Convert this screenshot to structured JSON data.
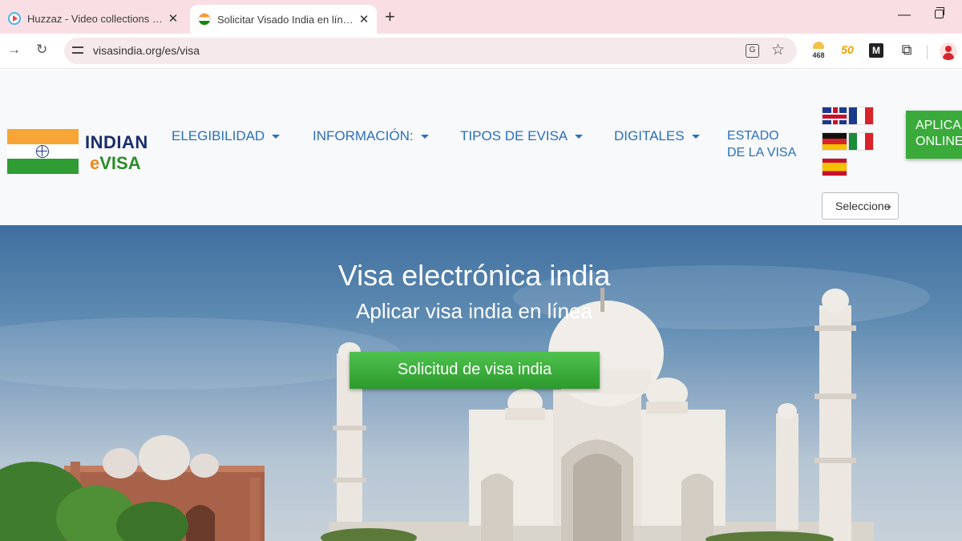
{
  "browser": {
    "tabs": [
      {
        "title": "Huzzaz - Video collections by k",
        "favicon": "huzzaz-play-icon",
        "active": false
      },
      {
        "title": "Solicitar Visado India en línea, S",
        "favicon": "india-flag-icon",
        "active": true
      }
    ],
    "new_tab_label": "+",
    "close_label": "✕",
    "url": "visasindia.org/es/visa",
    "extensions": {
      "weather_temp": "468",
      "fifty_label": "50",
      "m_label": "M"
    }
  },
  "site": {
    "logo": {
      "line1": "INDIAN",
      "line2_e": "e",
      "line2_rest": "VISA"
    },
    "nav": {
      "elegibilidad": "ELEGIBILIDAD",
      "informacion": "INFORMACIÓN:",
      "tipos": "TIPOS DE EVISA",
      "digitales": "DIGITALES",
      "estado_line1": "ESTADO",
      "estado_line2": "DE LA VISA"
    },
    "languages": [
      "english-flag",
      "french-flag",
      "german-flag",
      "italian-flag",
      "spanish-flag"
    ],
    "language_select": "Seleccione",
    "apply_button": {
      "line1": "APLICA",
      "line2": "ONLINE"
    }
  },
  "hero": {
    "title": "Visa electrónica india",
    "subtitle": "Aplicar visa india en línea",
    "cta": "Solicitud de visa india"
  },
  "colors": {
    "nav_link": "#2a6fbe",
    "apply_green": "#3aaa3a",
    "tab_bar": "#f9dfe4"
  }
}
